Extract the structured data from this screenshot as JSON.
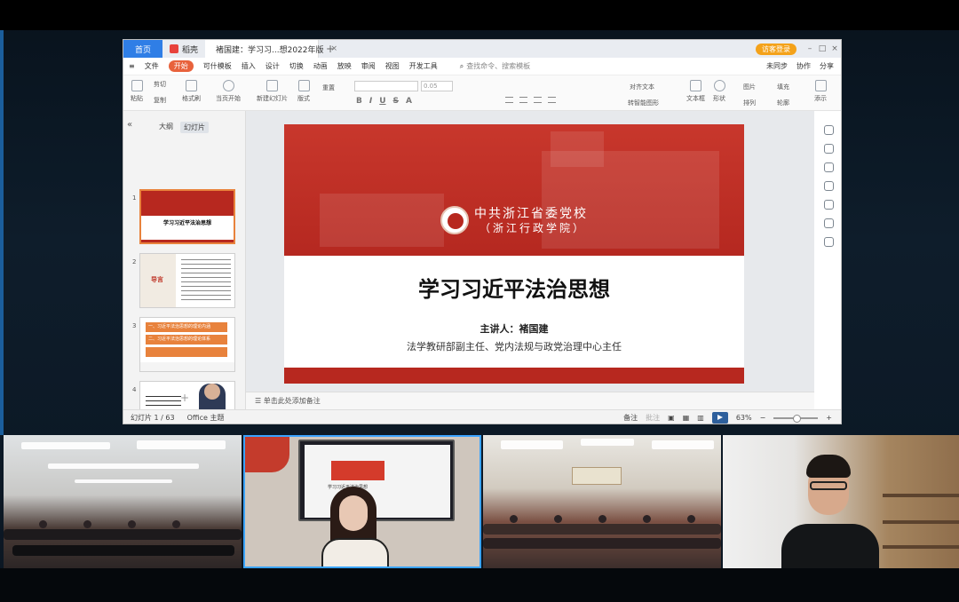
{
  "wps": {
    "tabs": {
      "home": "首页",
      "docer": "稻壳",
      "doc": "褚国建：学习习...想2022年版"
    },
    "login": "访客登录",
    "menu": [
      "文件",
      "开始",
      "设计",
      "切换",
      "动画",
      "放映",
      "审阅",
      "视图",
      "开发工具"
    ],
    "menu_extra": {
      "template": "可什模板",
      "insert": "插入"
    },
    "menu_search": "查找命令、搜索模板",
    "menu_right": {
      "sync": "未同步",
      "collab": "协作",
      "share": "分享"
    },
    "ribbon": {
      "paste": "粘贴",
      "cut": "剪切",
      "copy": "复制",
      "format": "格式刷",
      "play": "当页开始",
      "newslide": "新建幻灯片",
      "layout": "版式",
      "reset": "重置",
      "fontsize": "0.05",
      "textbox": "文本框",
      "shape": "形状",
      "arrange": "排列",
      "image": "图片",
      "fill": "填充",
      "outline": "轮廓",
      "align_text": "对齐文本",
      "smartart": "转智能图形",
      "addin": "添示"
    },
    "leftpane": {
      "tab_outline": "大纲",
      "tab_slides": "幻灯片",
      "thumbs": [
        {
          "num": "1",
          "title": "学习习近平法治思想"
        },
        {
          "num": "2",
          "title": "导言"
        },
        {
          "num": "3",
          "title": "一、习近平法治思想的理论内涵"
        },
        {
          "num": "4",
          "title": "二、习近平法治思想的理论体系"
        }
      ]
    },
    "slide": {
      "org_line1": "中共浙江省委党校",
      "org_line2": "（浙江行政学院）",
      "title": "学习习近平法治思想",
      "speaker": "主讲人：褚国建",
      "role": "法学教研部副主任、党内法规与政党治理中心主任"
    },
    "notes_placeholder": "单击此处添加备注",
    "status": {
      "slide_counter": "幻灯片 1 / 63",
      "theme": "Office 主题",
      "notes": "备注",
      "annot": "批注",
      "zoom": "63%"
    }
  },
  "colors": {
    "accent": "#e8623c",
    "slide_red": "#b7281f",
    "home_tab": "#2f7ee6",
    "active_video_border": "#3aa3ff"
  },
  "video": {
    "tiles": [
      "meeting-room-1",
      "presenter",
      "meeting-room-2",
      "speaker"
    ],
    "presenter_screen_text": "学习习近平法治思想"
  }
}
